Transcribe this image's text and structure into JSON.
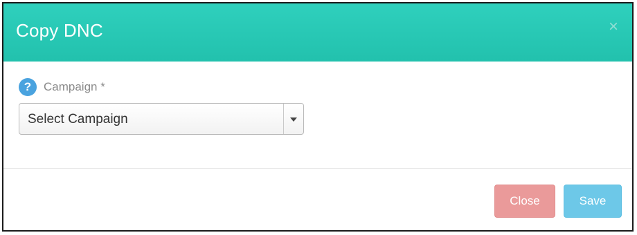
{
  "modal": {
    "title": "Copy DNC",
    "close_symbol": "×"
  },
  "form": {
    "help_icon": "question-circle-icon",
    "help_symbol": "?",
    "campaign_label": "Campaign *",
    "campaign_select_value": "Select Campaign"
  },
  "footer": {
    "close_label": "Close",
    "save_label": "Save"
  },
  "colors": {
    "header": "#22c1ad",
    "help_icon": "#4aa3df",
    "close_button": "#ea9a9a",
    "save_button": "#6dc8e8"
  }
}
